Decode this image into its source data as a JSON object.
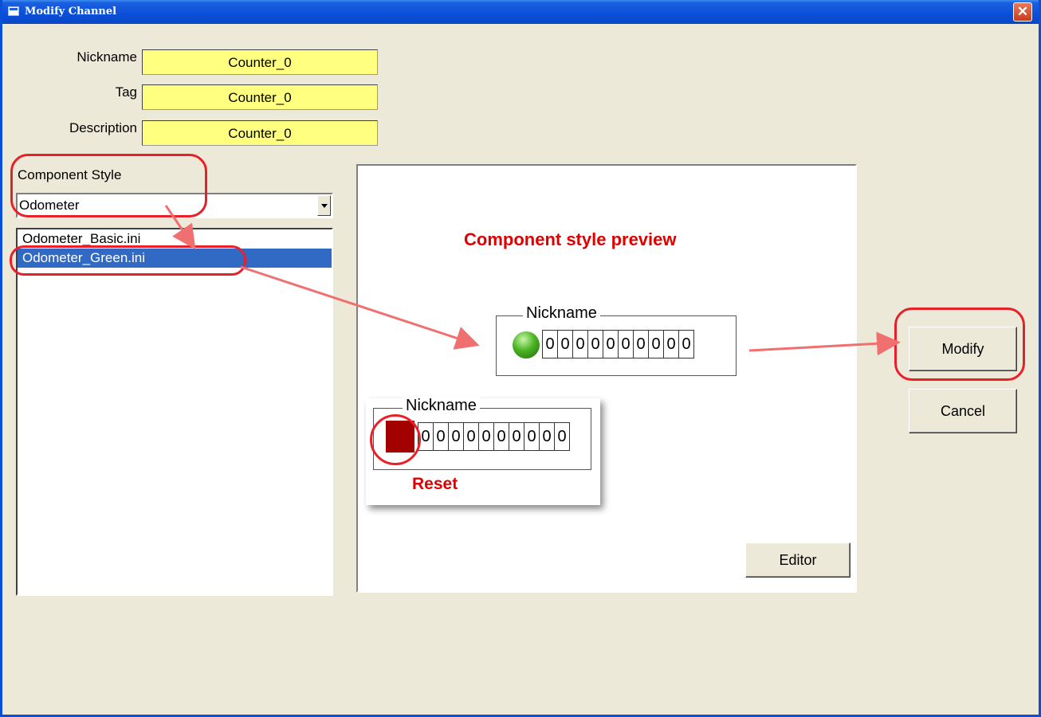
{
  "window": {
    "title": "Modify Channel",
    "close_glyph": "✕"
  },
  "form": {
    "nickname_label": "Nickname",
    "nickname_value": "Counter_0",
    "tag_label": "Tag",
    "tag_value": "Counter_0",
    "description_label": "Description",
    "description_value": "Counter_0"
  },
  "component_style": {
    "label": "Component Style",
    "selected": "Odometer",
    "files": [
      "Odometer_Basic.ini",
      "Odometer_Green.ini"
    ],
    "selected_file_index": 1
  },
  "preview": {
    "title": "Component style preview",
    "odometer_legend": "Nickname",
    "odometer_digits": [
      "0",
      "0",
      "0",
      "0",
      "0",
      "0",
      "0",
      "0",
      "0",
      "0"
    ],
    "reset_card_legend": "Nickname",
    "reset_card_digits": [
      "0",
      "0",
      "0",
      "0",
      "0",
      "0",
      "0",
      "0",
      "0",
      "0"
    ],
    "reset_label": "Reset",
    "editor_label": "Editor"
  },
  "buttons": {
    "modify_label": "Modify",
    "cancel_label": "Cancel"
  },
  "colors": {
    "field_bg": "#ffff80",
    "accent_red": "#e8202a",
    "selection": "#316ac5",
    "led_green": "#4cb324",
    "reset_red": "#a30000"
  },
  "icons": {
    "title": "window-icon",
    "close": "close-icon",
    "led": "green-led-icon",
    "dropdown": "chevron-down-icon"
  }
}
